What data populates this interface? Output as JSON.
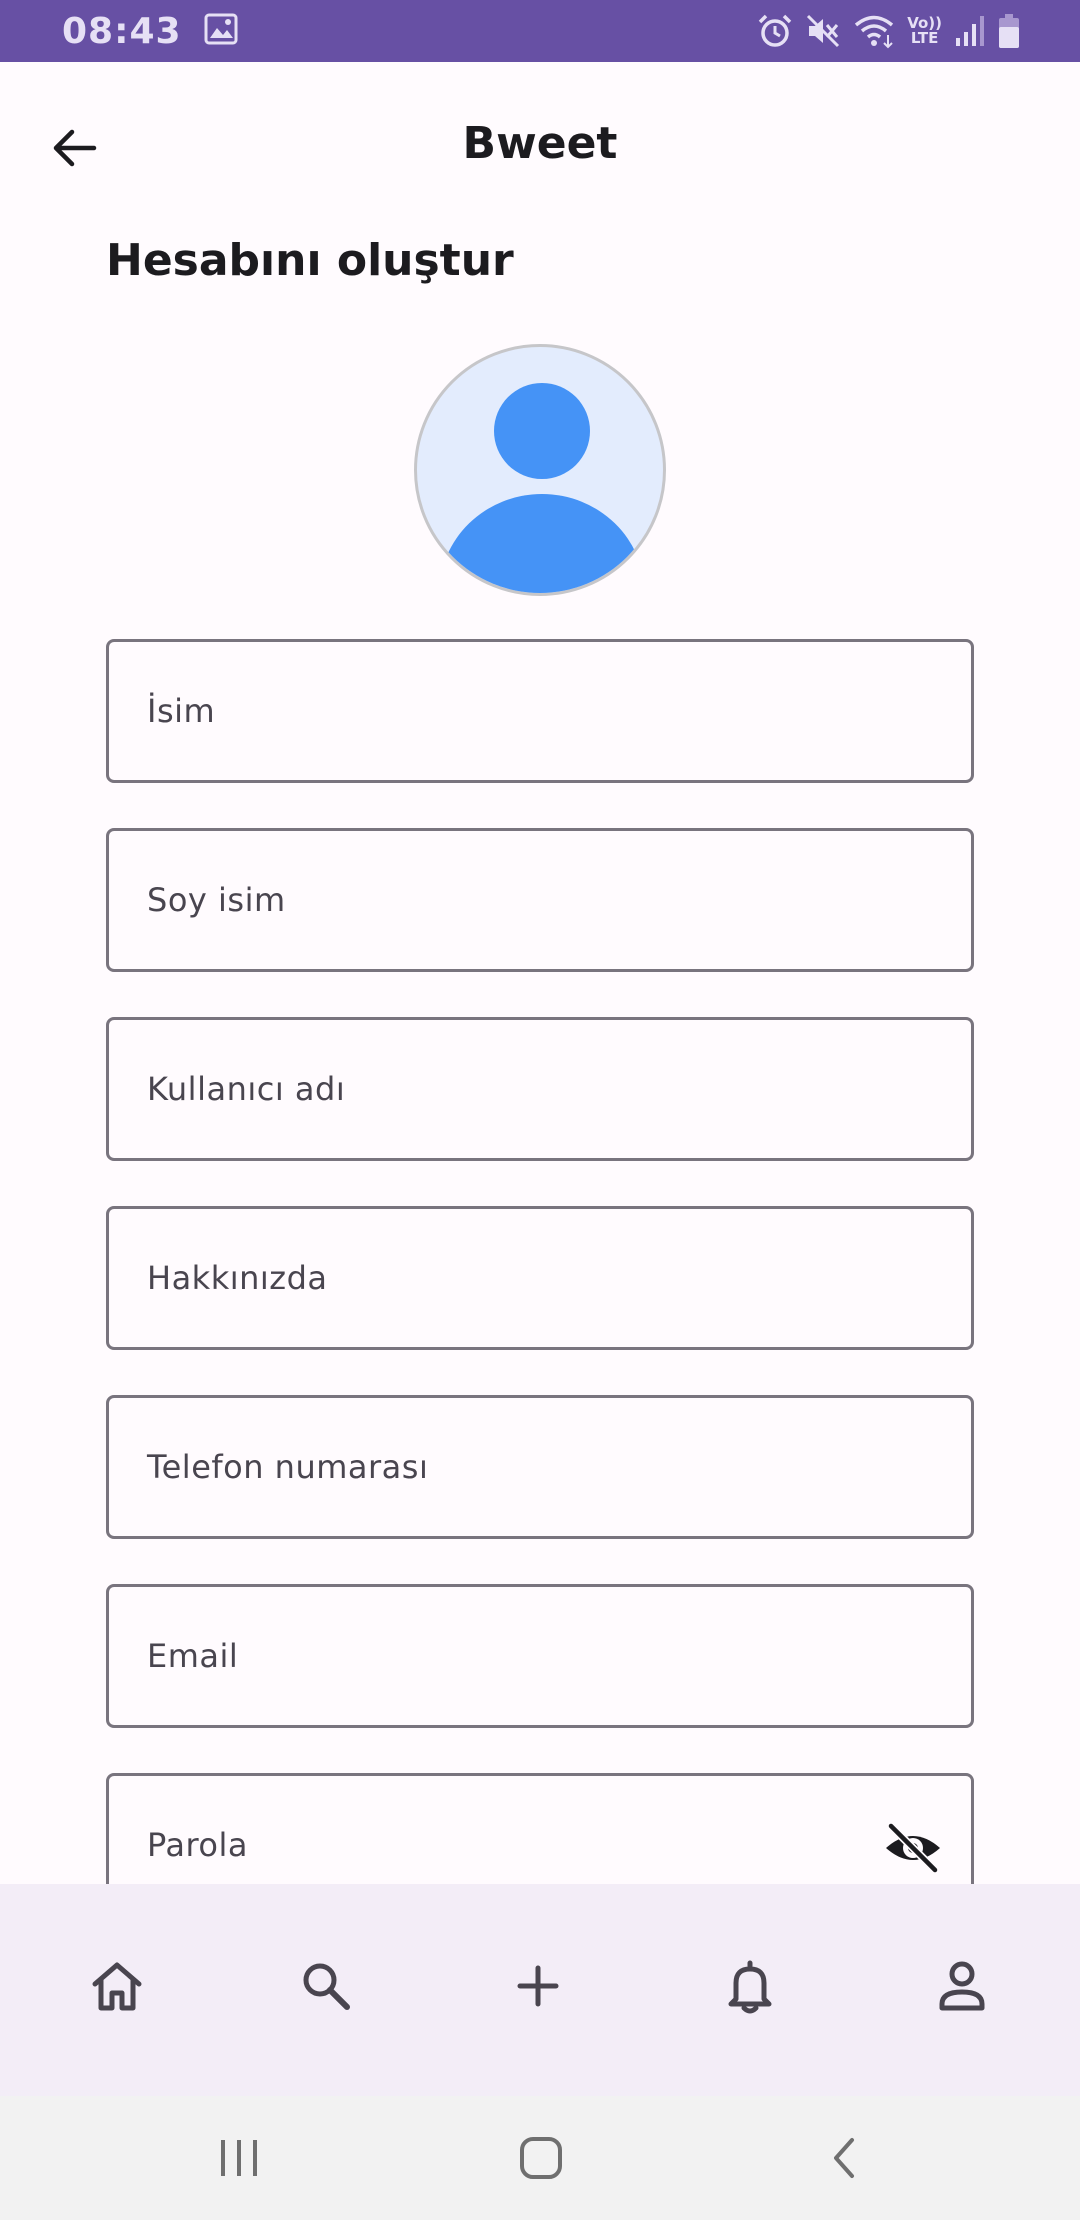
{
  "status_bar": {
    "time": "08:43",
    "icons": [
      "image-icon",
      "alarm-icon",
      "vibrate-mute-icon",
      "wifi-icon",
      "volte-icon",
      "signal-icon",
      "battery-icon"
    ],
    "volte_top": "Vo))",
    "volte_bottom": "LTE",
    "bg_color": "#6750a4"
  },
  "app_bar": {
    "title": "Bweet",
    "back_icon": "arrow-back-icon"
  },
  "form": {
    "heading": "Hesabını oluştur",
    "avatar_icon": "person-avatar-icon",
    "fields": {
      "first_name": "İsim",
      "last_name": "Soy isim",
      "username": "Kullanıcı adı",
      "about": "Hakkınızda",
      "phone": "Telefon numarası",
      "email": "Email",
      "password": "Parola"
    },
    "password_toggle_icon": "visibility-off-icon"
  },
  "bottom_nav": {
    "items": [
      "home-icon",
      "search-icon",
      "add-icon",
      "notifications-icon",
      "profile-icon"
    ],
    "bg_color": "#f3edf7"
  },
  "system_nav": {
    "items": [
      "recents-icon",
      "home-circle-icon",
      "back-chevron-icon"
    ]
  },
  "colors": {
    "accent": "#6750a4",
    "avatar_blue": "#4593f6",
    "avatar_bg": "#e3ecfd",
    "outline": "#79747e"
  }
}
